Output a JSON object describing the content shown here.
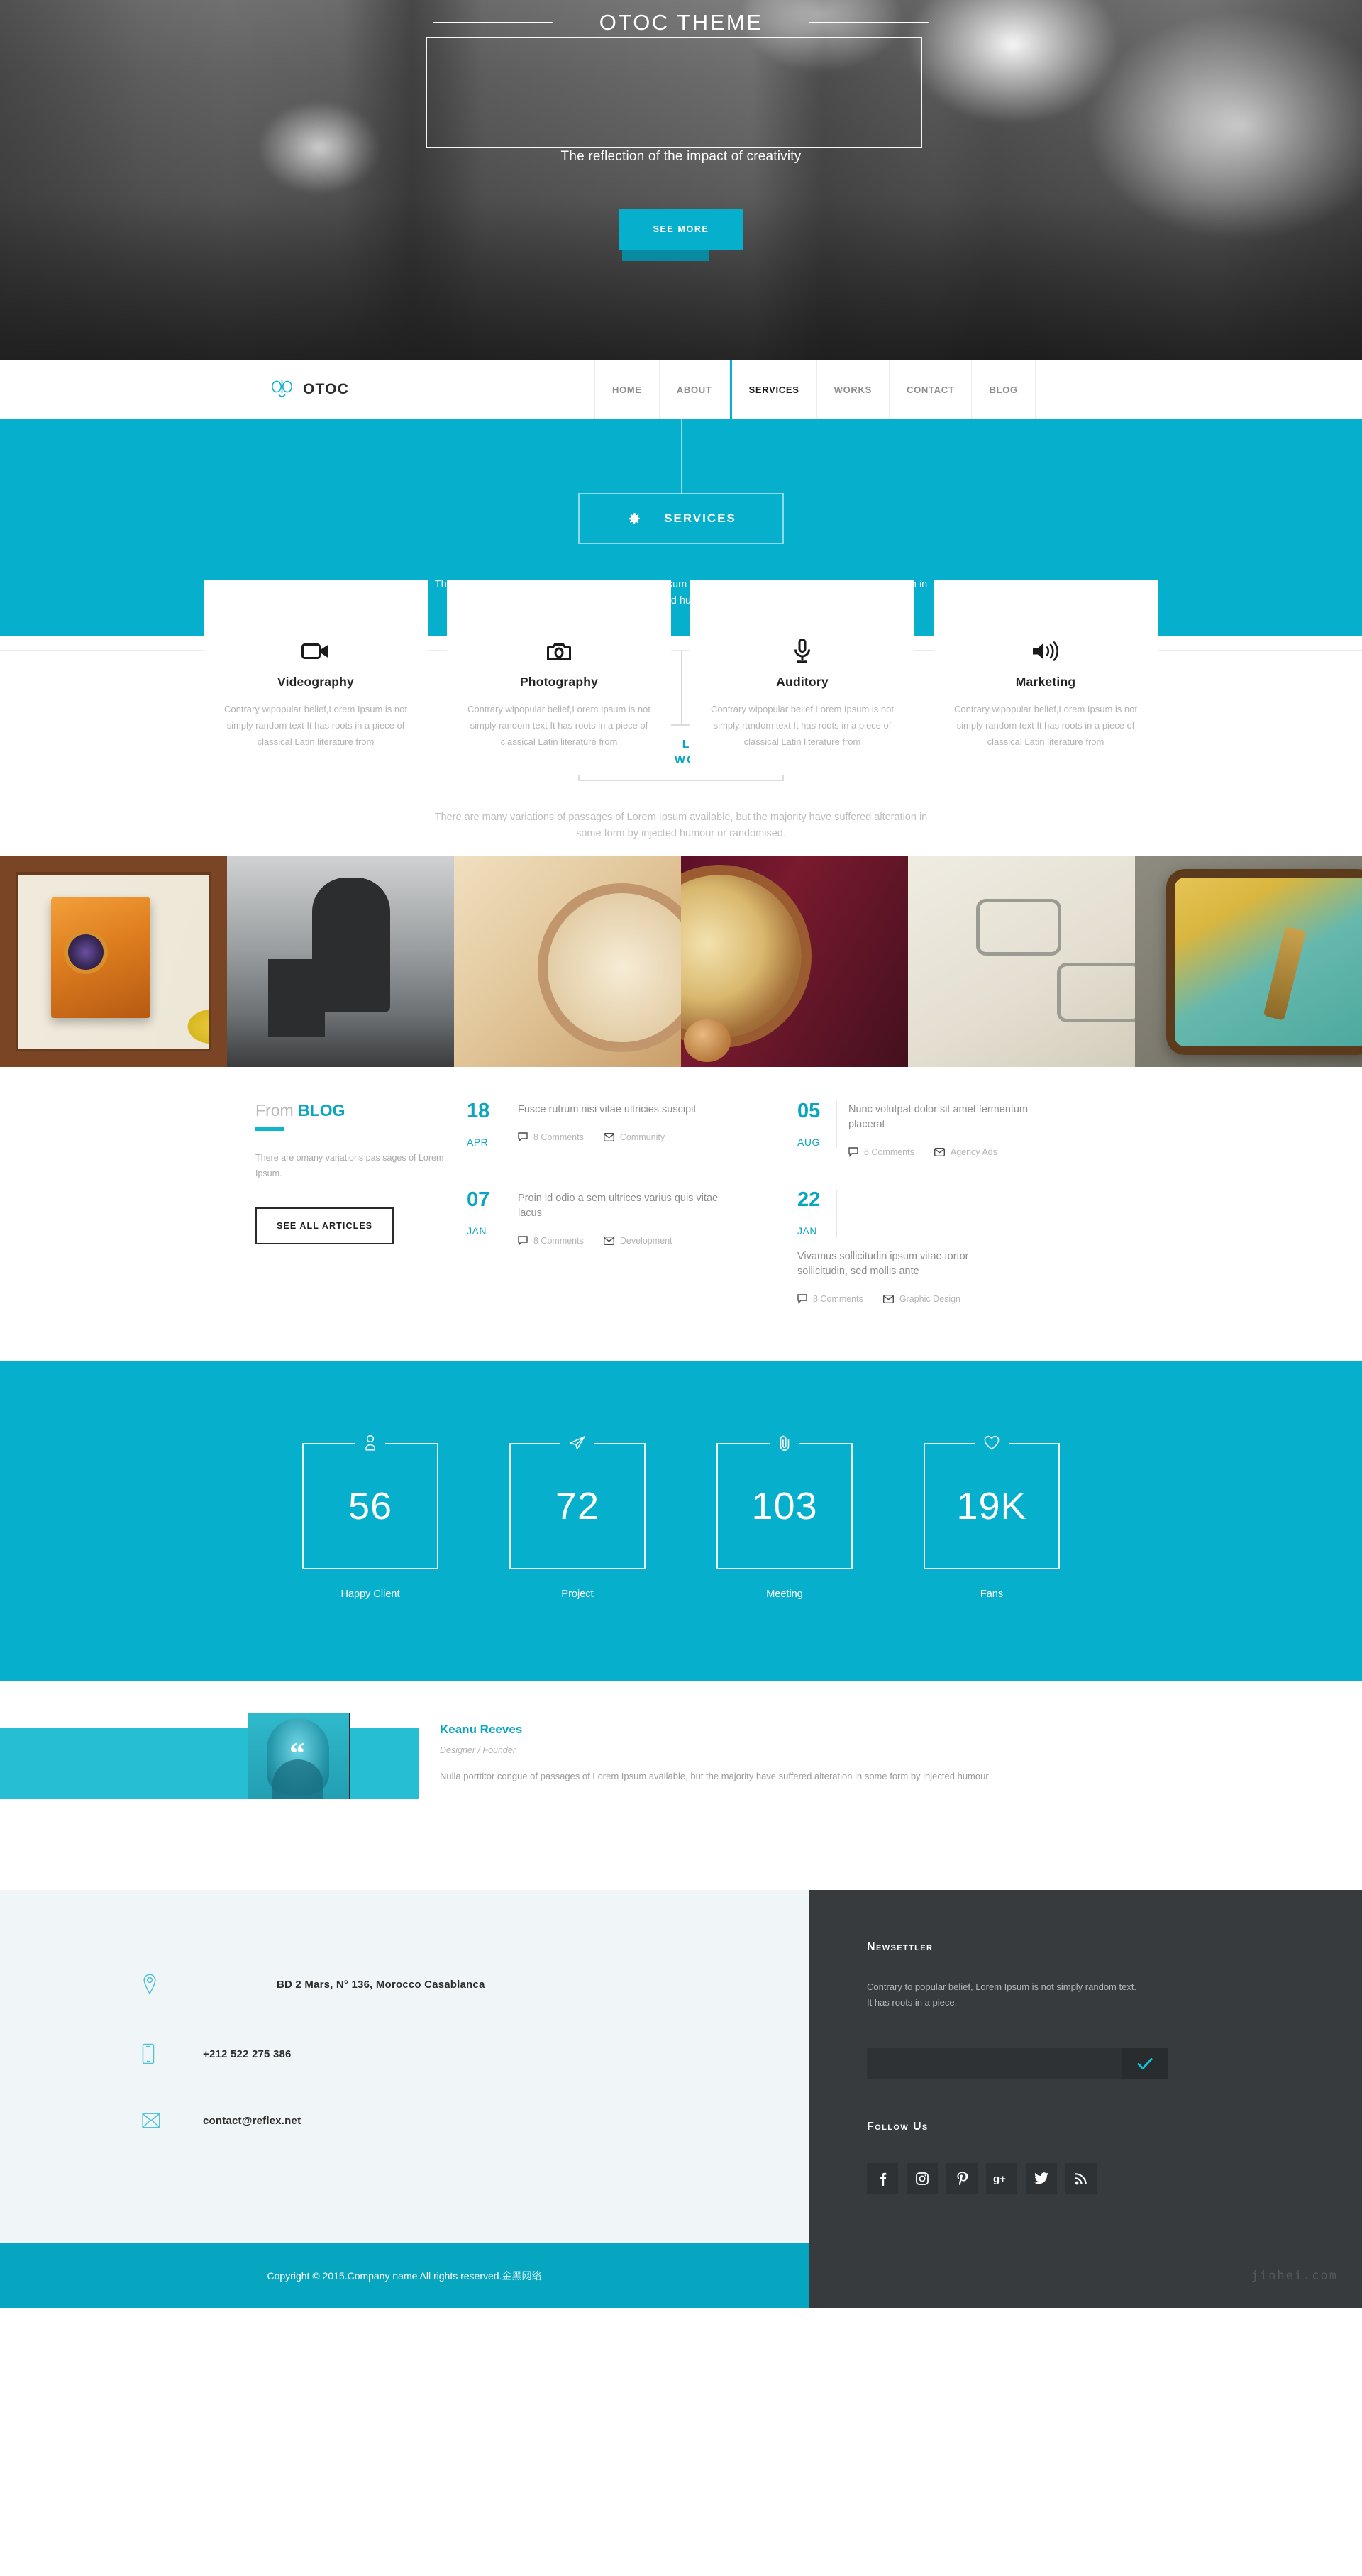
{
  "hero": {
    "title": "OTOC THEME",
    "subtitle": "The reflection of the impact of creativity",
    "button": "SEE MORE"
  },
  "nav": {
    "brand": "OTOC",
    "items": [
      {
        "label": "HOME",
        "active": false
      },
      {
        "label": "ABOUT",
        "active": false
      },
      {
        "label": "SERVICES",
        "active": true
      },
      {
        "label": "WORKS",
        "active": false
      },
      {
        "label": "CONTACT",
        "active": false
      },
      {
        "label": "BLOG",
        "active": false
      }
    ]
  },
  "services": {
    "badge": "SERVICES",
    "description": "There are many variations of passages of Lorem Ipsum available, but the majority have suffered alteration in some form by injected humour or randomised.",
    "cards": [
      {
        "icon": "video-camera-icon",
        "title": "Videography",
        "text": "Contrary wipopular belief,Lorem Ipsum is not simply random text It has roots in a piece of classical Latin literature from"
      },
      {
        "icon": "camera-icon",
        "title": "Photography",
        "text": "Contrary wipopular belief,Lorem Ipsum is not simply random text It has roots in a piece of classical Latin literature from"
      },
      {
        "icon": "microphone-icon",
        "title": "Auditory",
        "text": "Contrary wipopular belief,Lorem Ipsum is not simply random text It has roots in a piece of classical Latin literature from"
      },
      {
        "icon": "speaker-icon",
        "title": "Marketing",
        "text": "Contrary wipopular belief,Lorem Ipsum is not simply random text It has roots in a piece of classical Latin literature from"
      }
    ]
  },
  "works": {
    "badge_line1": "LAST",
    "badge_line2": "WORKS",
    "description": "There are many variations of passages of Lorem Ipsum available, but the majority have suffered alteration in some form by injected humour or randomised.",
    "items": [
      {
        "alt": "vintage-camera-sketch"
      },
      {
        "alt": "thumbs-up-illustration"
      },
      {
        "alt": "antique-clock-drawing"
      },
      {
        "alt": "red-wall-clock"
      },
      {
        "alt": "product-sketch-notebook"
      },
      {
        "alt": "hand-with-flag-game-icon"
      }
    ]
  },
  "blog": {
    "title_light": "From ",
    "title_bold": "BLOG",
    "intro": "There are omany variations pas sages of Lorem Ipsum.",
    "button": "SEE ALL ARTICLES",
    "posts": [
      {
        "day": "18",
        "month": "APR",
        "title": "Fusce rutrum nisi vitae ultricies suscipit",
        "comments": "8 Comments",
        "category": "Community"
      },
      {
        "day": "05",
        "month": "AUG",
        "title": "Nunc volutpat dolor sit amet fermentum placerat",
        "comments": "8 Comments",
        "category": "Agency Ads"
      },
      {
        "day": "07",
        "month": "JAN",
        "title": "Proin id odio a sem ultrices varius quis vitae lacus",
        "comments": "8 Comments",
        "category": "Development"
      },
      {
        "day": "22",
        "month": "JAN",
        "title": "Vivamus sollicitudin ipsum vitae tortor sollicitudin, sed mollis ante",
        "comments": "8 Comments",
        "category": "Graphic Design"
      }
    ]
  },
  "counters": [
    {
      "icon": "user-icon",
      "value": "56",
      "label": "Happy Client"
    },
    {
      "icon": "paper-plane-icon",
      "value": "72",
      "label": "Project"
    },
    {
      "icon": "paperclip-icon",
      "value": "103",
      "label": "Meeting"
    },
    {
      "icon": "heart-icon",
      "value": "19K",
      "label": "Fans"
    }
  ],
  "testimonial": {
    "name": "Keanu Reeves",
    "role": "Designer / Founder",
    "quote": "Nulla porttitor congue of passages of Lorem Ipsum available, but the majority have suffered alteration in some form by injected humour"
  },
  "footer": {
    "contacts": [
      {
        "icon": "map-pin-icon",
        "text": "BD 2 Mars, N° 136, Morocco Casablanca"
      },
      {
        "icon": "mobile-phone-icon",
        "text": "+212 522 275 386"
      },
      {
        "icon": "envelope-icon",
        "text": "contact@reflex.net"
      }
    ],
    "newsletter_heading": "Newsettler",
    "newsletter_text": "Contrary to popular belief, Lorem Ipsum is not simply random text. It has roots in a piece.",
    "newsletter_input_value": "",
    "newsletter_placeholder": "",
    "newsletter_submit_icon": "check-icon",
    "follow_heading": "Follow us",
    "socials": [
      {
        "icon": "facebook-icon",
        "label": "f"
      },
      {
        "icon": "instagram-icon",
        "label": ""
      },
      {
        "icon": "pinterest-icon",
        "label": "p"
      },
      {
        "icon": "google-plus-icon",
        "label": "g+"
      },
      {
        "icon": "twitter-icon",
        "label": ""
      },
      {
        "icon": "rss-icon",
        "label": ""
      }
    ],
    "copyright": "Copyright © 2015.Company name All rights reserved.",
    "copyright_cn": "金黑网络",
    "watermark": "jinhei.com"
  },
  "colors": {
    "accent": "#06b0cc",
    "accent_dark": "#068ba2",
    "accent_light": "#26bed2",
    "footer_dark": "#373b3e",
    "footer_light": "#f0f6f7"
  }
}
